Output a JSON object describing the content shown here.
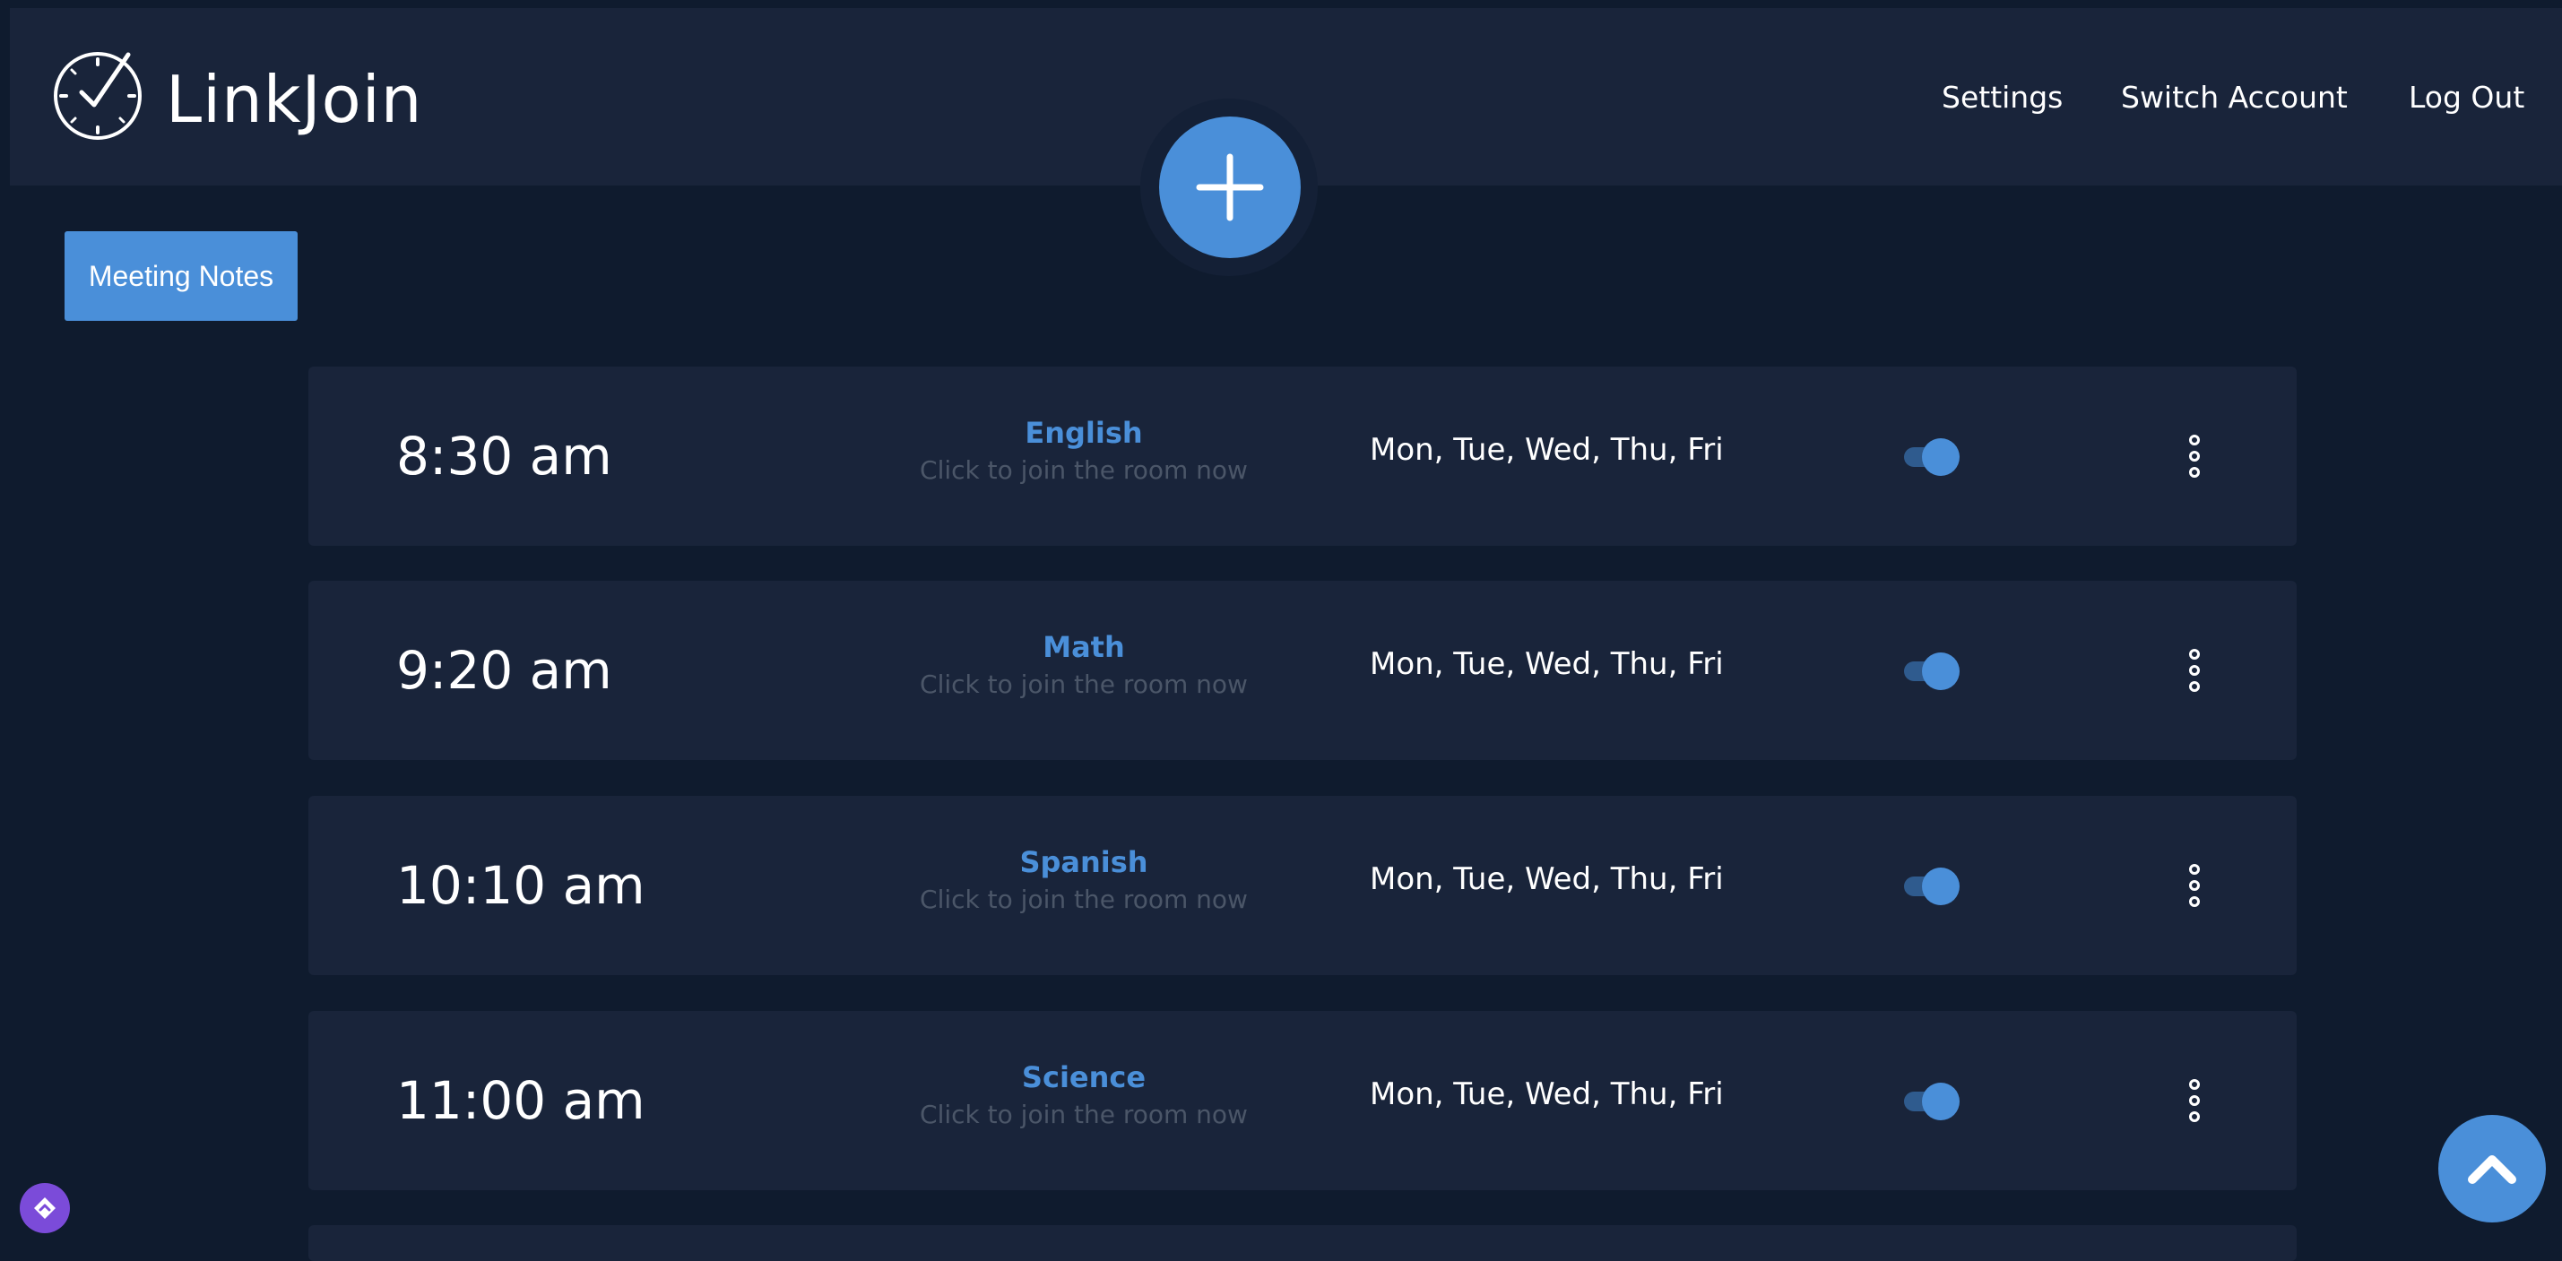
{
  "app": {
    "brand": "LinkJoin",
    "logo_icon": "clock-check-icon"
  },
  "nav": {
    "settings": "Settings",
    "switch_account": "Switch Account",
    "log_out": "Log Out"
  },
  "actions": {
    "add_icon": "plus-icon",
    "meeting_notes": "Meeting Notes",
    "scroll_top_icon": "chevron-up-icon"
  },
  "colors": {
    "background": "#0f1b2e",
    "panel": "#19243a",
    "accent": "#4a8fd9",
    "muted_text": "#4b5668"
  },
  "meetings": [
    {
      "time": "8:30 am",
      "name": "English",
      "hint": "Click to join the room now",
      "days": "Mon, Tue, Wed, Thu, Fri",
      "enabled": true
    },
    {
      "time": "9:20 am",
      "name": "Math",
      "hint": "Click to join the room now",
      "days": "Mon, Tue, Wed, Thu, Fri",
      "enabled": true
    },
    {
      "time": "10:10 am",
      "name": "Spanish",
      "hint": "Click to join the room now",
      "days": "Mon, Tue, Wed, Thu, Fri",
      "enabled": true
    },
    {
      "time": "11:00 am",
      "name": "Science",
      "hint": "Click to join the room now",
      "days": "Mon, Tue, Wed, Thu, Fri",
      "enabled": true
    }
  ]
}
